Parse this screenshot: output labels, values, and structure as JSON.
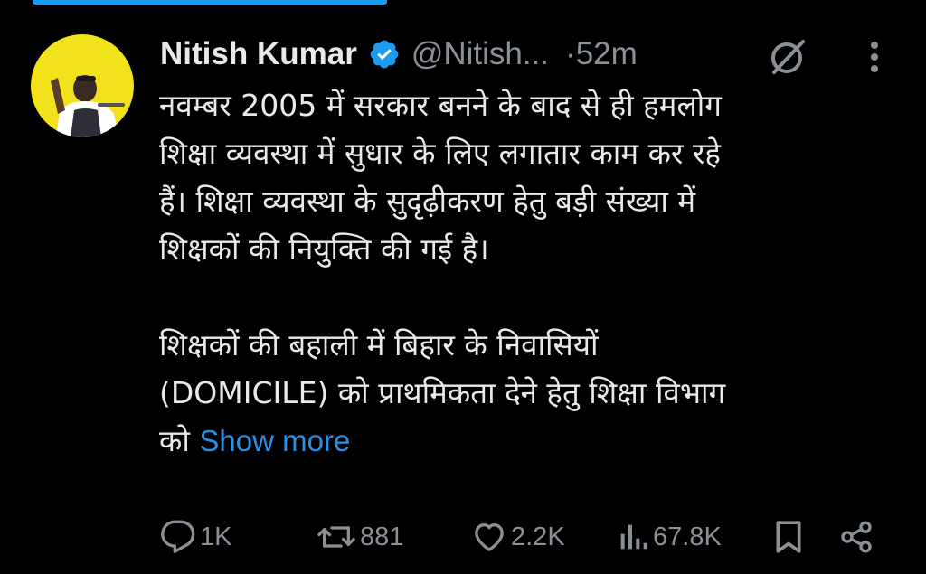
{
  "colors": {
    "background": "#000000",
    "text": "#e7e9ea",
    "muted": "#8b9096",
    "link": "#2c8ee0",
    "verified": "#1d9bf0",
    "top_bar": "#1d9bf0",
    "avatar_bg": "#f2e21b"
  },
  "tweet": {
    "author": {
      "name": "Nitish Kumar",
      "handle": "@Nitish...",
      "verified_icon": "verified-badge-icon"
    },
    "time": "·52m",
    "text_para1": "नवम्बर 2005 में सरकार बनने के बाद से ही हमलोग\nशिक्षा व्यवस्था में सुधार के लिए लगातार काम कर रहे\nहैं। शिक्षा व्यवस्था के सुदृढ़ीकरण हेतु बड़ी संख्या में\nशिक्षकों की नियुक्ति की गई है।",
    "text_para2": "शिक्षकों की बहाली में बिहार के निवासियों\n(DOMICILE) को प्राथमिकता देने हेतु शिक्षा विभाग\nको ",
    "show_more": "Show more"
  },
  "actions": {
    "reply": {
      "icon": "reply-icon",
      "count": "1K"
    },
    "retweet": {
      "icon": "retweet-icon",
      "count": "881"
    },
    "like": {
      "icon": "heart-icon",
      "count": "2.2K"
    },
    "views": {
      "icon": "views-icon",
      "count": "67.8K"
    },
    "bookmark": {
      "icon": "bookmark-icon"
    },
    "share": {
      "icon": "share-icon"
    }
  }
}
